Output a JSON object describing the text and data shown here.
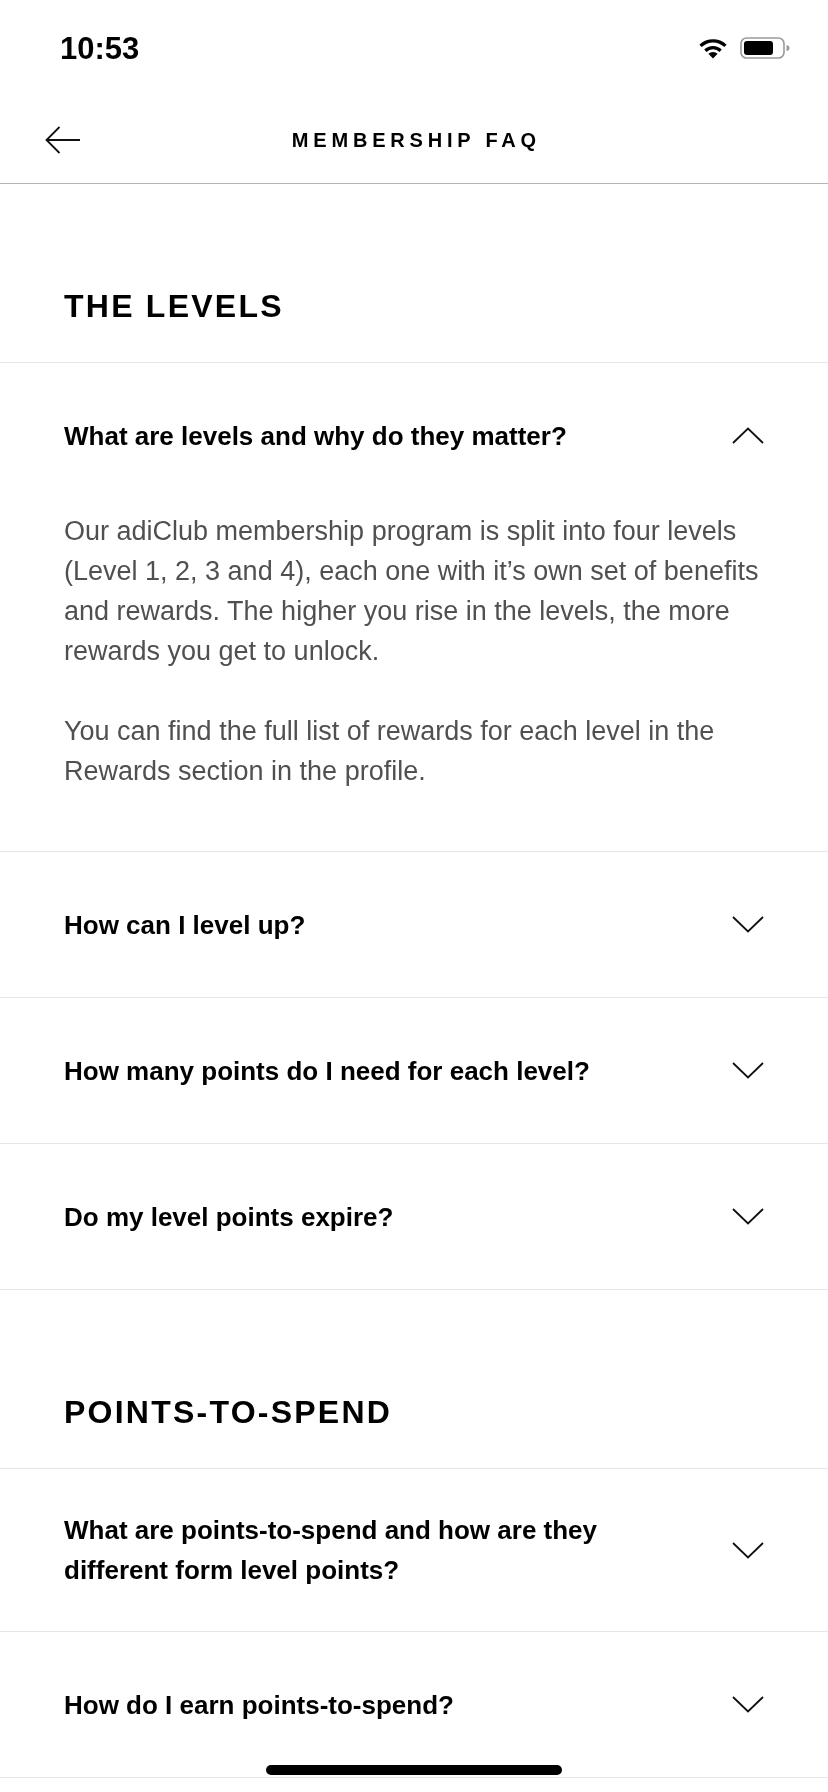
{
  "status_bar": {
    "time": "10:53"
  },
  "nav_bar": {
    "title": "MEMBERSHIP FAQ"
  },
  "sections": [
    {
      "heading": "THE LEVELS",
      "items": [
        {
          "question": "What are levels and why do they matter?",
          "expanded": true,
          "answer": [
            "Our adiClub membership program is split into four levels (Level 1, 2, 3 and 4), each one with it’s own set of benefits and rewards. The higher you rise in the levels, the more rewards you get to unlock.",
            "You can find the full list of rewards for each level in the Rewards section in the profile."
          ]
        },
        {
          "question": "How can I level up?",
          "expanded": false
        },
        {
          "question": "How many points do I need for each level?",
          "expanded": false
        },
        {
          "question": "Do my level points expire?",
          "expanded": false
        }
      ]
    },
    {
      "heading": "POINTS-TO-SPEND",
      "items": [
        {
          "question": "What are points-to-spend and how are they different form level points?",
          "expanded": false
        },
        {
          "question": "How do I earn points-to-spend?",
          "expanded": false
        }
      ]
    }
  ]
}
